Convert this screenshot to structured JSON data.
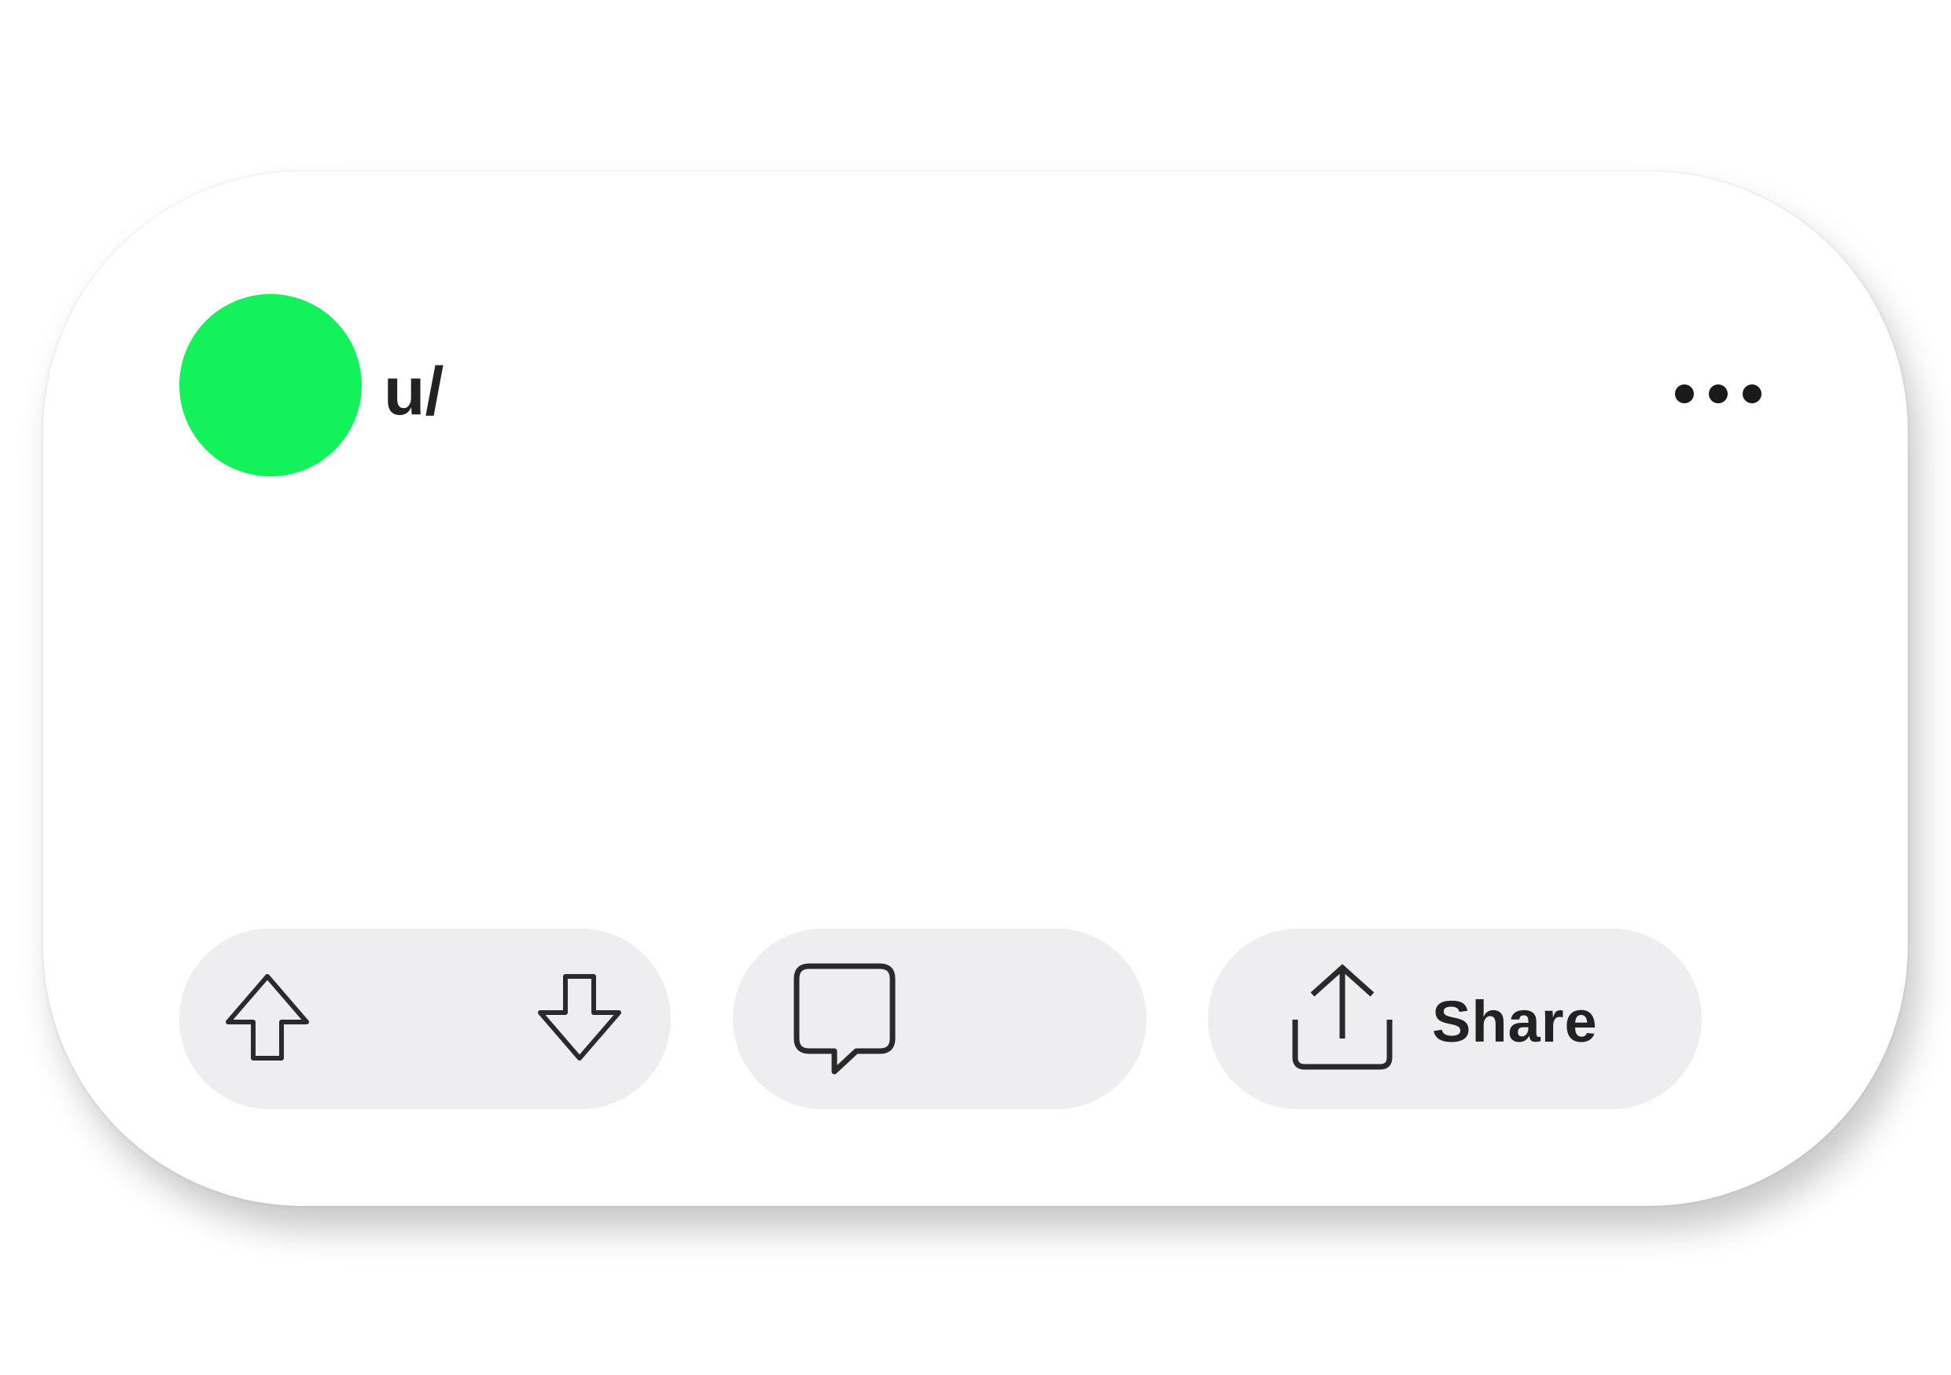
{
  "post": {
    "author_prefix": "u/",
    "avatar_color": "#13f25a",
    "more_icon": "more-horizontal-icon"
  },
  "actions": {
    "upvote_icon": "arrow-up-icon",
    "downvote_icon": "arrow-down-icon",
    "comment_icon": "comment-bubble-icon",
    "share_icon": "share-upload-icon",
    "share_label": "Share"
  }
}
